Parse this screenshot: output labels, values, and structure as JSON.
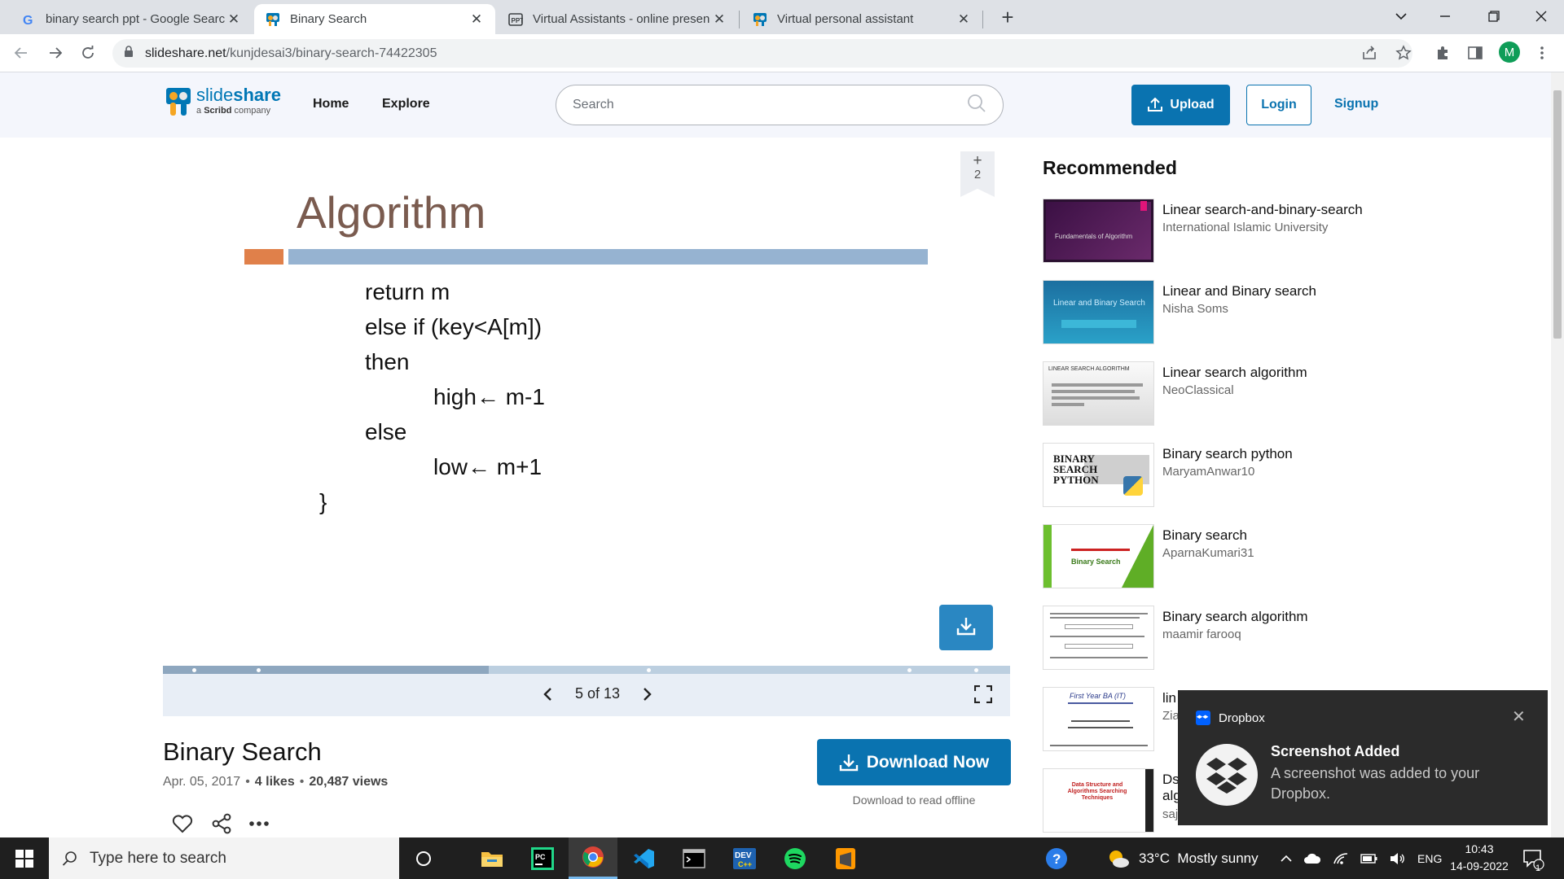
{
  "browser": {
    "tabs": [
      {
        "title": "binary search ppt - Google Searc"
      },
      {
        "title": "Binary Search"
      },
      {
        "title": "Virtual Assistants - online presen"
      },
      {
        "title": "Virtual personal assistant"
      }
    ],
    "address": {
      "domain": "slideshare.net",
      "path": "/kunjdesai3/binary-search-74422305"
    },
    "profile_initial": "M"
  },
  "header": {
    "logo_word": "slide",
    "logo_word_bold": "share",
    "logo_sub_prefix": "a ",
    "logo_sub_brand": "Scribd",
    "logo_sub_suffix": " company",
    "nav": [
      "Home",
      "Explore"
    ],
    "search_placeholder": "Search",
    "upload_label": "Upload",
    "login_label": "Login",
    "signup_label": "Signup"
  },
  "slide": {
    "title": "Algorithm",
    "lines": [
      "return m",
      "else if (key<A[m])",
      "then",
      "high← m-1",
      "else",
      "low← m+1",
      "}"
    ],
    "bookmark_plus": "+",
    "bookmark_count": "2",
    "current_page": 5,
    "total_pages": 13,
    "page_label": "5 of 13",
    "progress_fraction": 0.385
  },
  "document": {
    "title": "Binary Search",
    "date": "Apr. 05, 2017",
    "likes": "4 likes",
    "views": "20,487 views",
    "download_label": "Download Now",
    "download_sub": "Download to read offline"
  },
  "recommended": {
    "heading": "Recommended",
    "items": [
      {
        "title": "Linear search-and-binary-search",
        "author": "International Islamic University",
        "thumb_text": "Fundamentals of Algorithm"
      },
      {
        "title": "Linear and Binary search",
        "author": "Nisha Soms",
        "thumb_text": "Linear and Binary Search"
      },
      {
        "title": "Linear search algorithm",
        "author": "NeoClassical",
        "thumb_text": "LINEAR SEARCH ALGORITHM"
      },
      {
        "title": "Binary search python",
        "author": "MaryamAnwar10",
        "thumb_text": "BINARY SEARCH PYTHON"
      },
      {
        "title": "Binary search",
        "author": "AparnaKumari31",
        "thumb_text": "Binary Search"
      },
      {
        "title": "Binary search algorithm",
        "author": "maamir farooq",
        "thumb_text": ""
      },
      {
        "title": "lin",
        "author": "Zia",
        "thumb_text": "First Year BA (IT)"
      },
      {
        "title": "Ds",
        "author": "saj",
        "thumb_text": "Data Structure and Algorithms Searching Techniques"
      }
    ],
    "partial_line2": "alg"
  },
  "toast": {
    "app": "Dropbox",
    "title": "Screenshot Added",
    "message": "A screenshot was added to your Dropbox."
  },
  "taskbar": {
    "search_placeholder": "Type here to search",
    "weather": "33°C  Mostly sunny",
    "language": "ENG",
    "time": "10:43",
    "date": "14-09-2022",
    "notification_count": "1"
  },
  "colors": {
    "brand": "#0a73b0",
    "slide_title": "#7a5b4f",
    "slide_bar_orange": "#e0804a",
    "slide_bar_blue": "#96b3d1"
  }
}
